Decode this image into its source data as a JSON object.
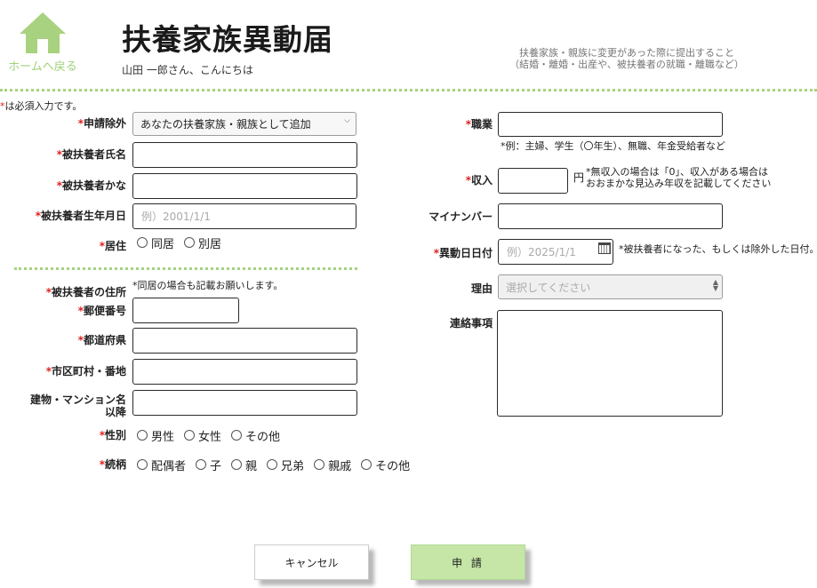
{
  "header": {
    "home_label": "ホームへ戻る",
    "title": "扶養家族異動届",
    "greeting": "山田 一郎さん、こんにちは",
    "description_line1": "扶養家族・親族に変更があった際に提出すること",
    "description_line2": "（結婚・離婚・出産や、被扶養者の就職・離職など）"
  },
  "form": {
    "required_mark": "*",
    "required_note": "は必須入力です。",
    "application_type": {
      "label": "申請除外",
      "value": "あなたの扶養家族・親族として追加"
    },
    "dependent_name": {
      "label": "被扶養者氏名",
      "value": ""
    },
    "dependent_kana": {
      "label": "被扶養者かな",
      "value": ""
    },
    "dependent_birthdate": {
      "label": "被扶養者生年月日",
      "placeholder": "例）2001/1/1"
    },
    "residence": {
      "label": "居住",
      "options": [
        "同居",
        "別居"
      ]
    },
    "address": {
      "label": "被扶養者の住所",
      "note": "*同居の場合も記載お願いします。",
      "postal_label": "郵便番号",
      "prefecture_label": "都道府県",
      "city_label": "市区町村・番地",
      "building_label_line1": "建物・マンション名",
      "building_label_line2": "以降"
    },
    "gender": {
      "label": "性別",
      "options": [
        "男性",
        "女性",
        "その他"
      ]
    },
    "relationship": {
      "label": "続柄",
      "options": [
        "配偶者",
        "子",
        "親",
        "兄弟",
        "親戚",
        "その他"
      ]
    },
    "occupation": {
      "label": "職業",
      "hint": "*例：主婦、学生（〇年生）、無職、年金受給者など"
    },
    "income": {
      "label": "収入",
      "unit": "円",
      "hint_line1": "*無収入の場合は「0」、収入がある場合は",
      "hint_line2": "おおまかな見込み年収を記載してください"
    },
    "my_number": {
      "label": "マイナンバー"
    },
    "change_date": {
      "label": "異動日日付",
      "placeholder": "例）2025/1/1",
      "hint": "*被扶養者になった、もしくは除外した日付。"
    },
    "reason": {
      "label": "理由",
      "placeholder": "選択してください"
    },
    "notes": {
      "label": "連絡事項"
    }
  },
  "buttons": {
    "cancel": "キャンセル",
    "submit": "申 請"
  },
  "colors": {
    "accent_green": "#a8d27f",
    "submit_bg": "#c5e6a6",
    "required_red": "#e02020"
  }
}
